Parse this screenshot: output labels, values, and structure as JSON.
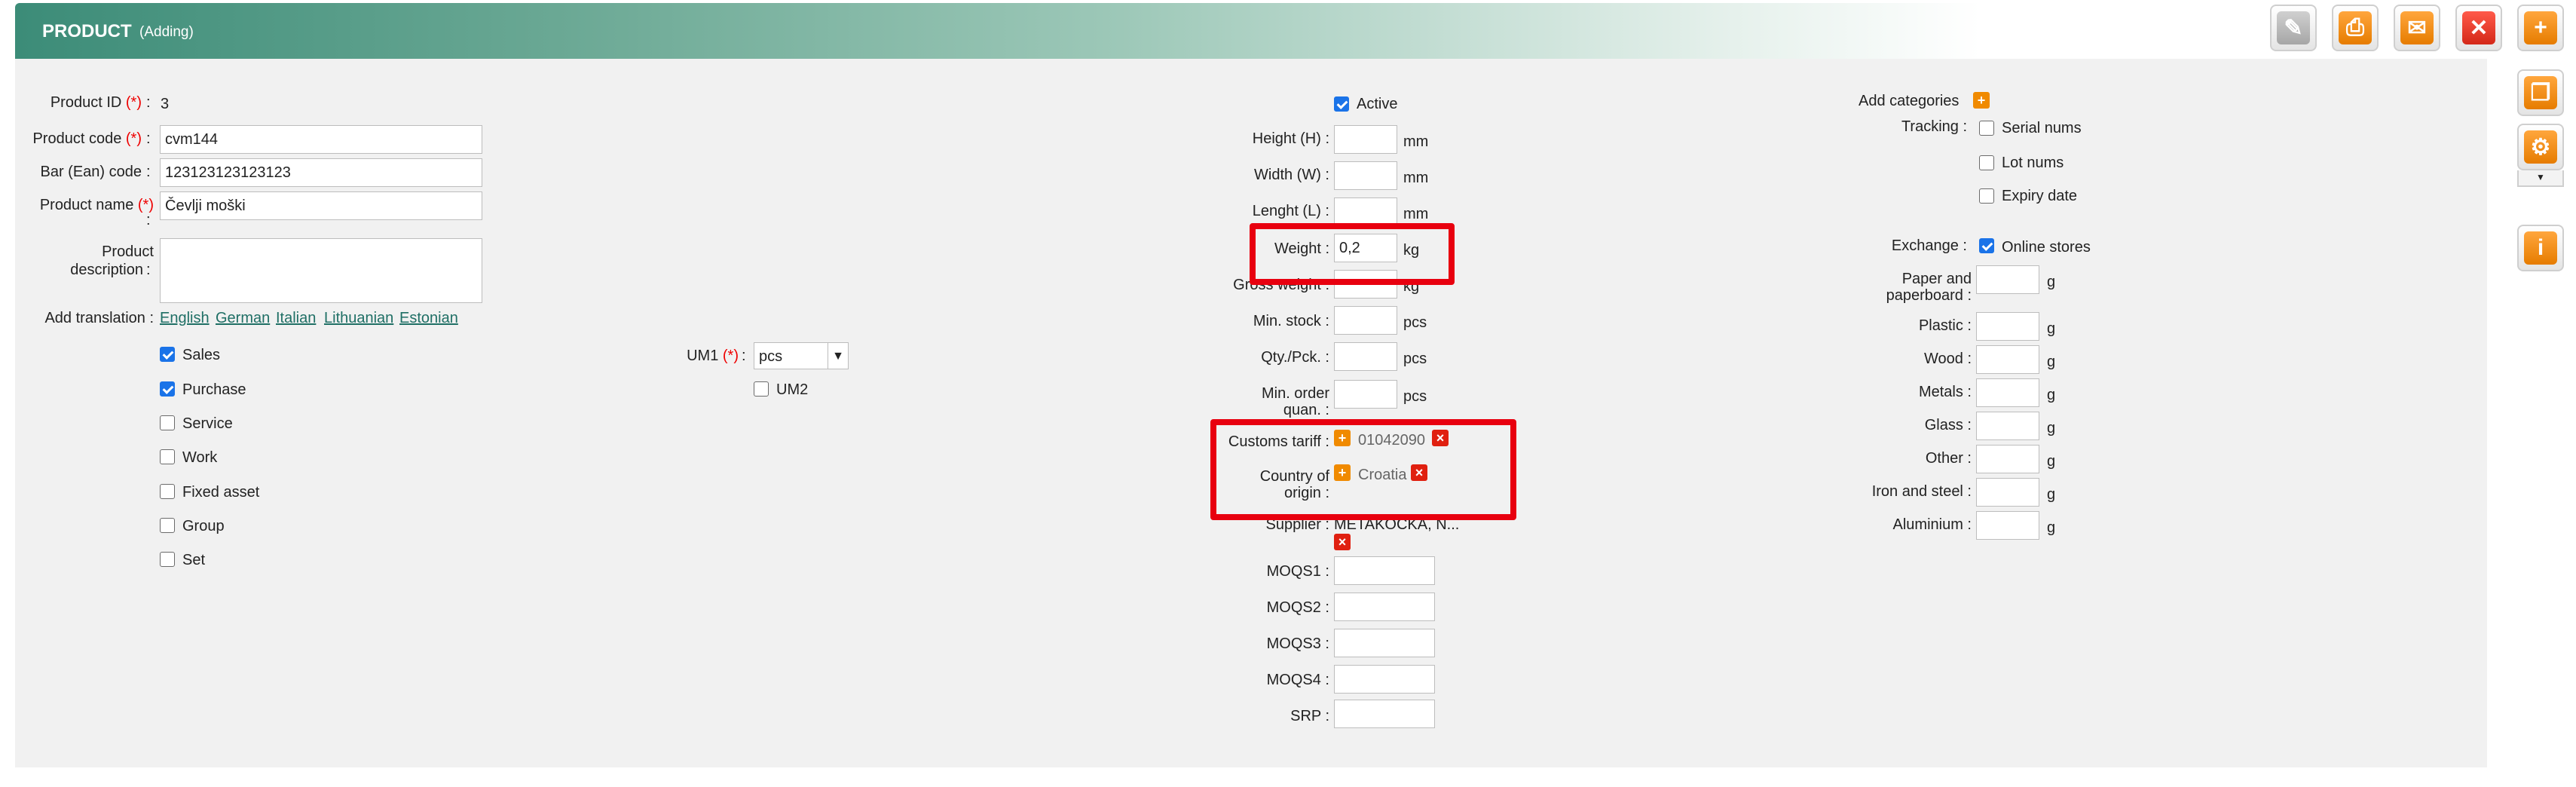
{
  "header": {
    "title": "PRODUCT",
    "subtitle": "(Adding)"
  },
  "toolbar": {
    "edit_icon": "pencil-icon",
    "print_icon": "printer-icon",
    "mail_icon": "envelope-icon",
    "close_icon": "close-icon",
    "add_icon": "plus-icon",
    "copy_icon": "copy-icon",
    "settings_icon": "gear-icon",
    "info_icon": "info-icon"
  },
  "left": {
    "product_id_label": "Product ID",
    "product_id_value": "3",
    "product_code_label": "Product code",
    "product_code_value": "cvm144",
    "barcode_label": "Bar (Ean) code",
    "barcode_value": "123123123123123",
    "product_name_label": "Product name",
    "product_name_value": "Čevlji moški",
    "description_label_1": "Product",
    "description_label_2": "description",
    "description_value": "",
    "required_mark": "(*)",
    "colon": ":",
    "add_translation_label": "Add translation :",
    "translations": [
      "English",
      "German",
      "Italian",
      "Lithuanian",
      "Estonian"
    ],
    "flags": [
      {
        "label": "Sales",
        "checked": true
      },
      {
        "label": "Purchase",
        "checked": true
      },
      {
        "label": "Service",
        "checked": false
      },
      {
        "label": "Work",
        "checked": false
      },
      {
        "label": "Fixed asset",
        "checked": false
      },
      {
        "label": "Group",
        "checked": false
      },
      {
        "label": "Set",
        "checked": false
      }
    ],
    "um1_label": "UM1",
    "um1_value": "pcs",
    "um2_label": "UM2",
    "um2_checked": false
  },
  "middle": {
    "active_label": "Active",
    "active_checked": true,
    "height_label": "Height (H) :",
    "width_label": "Width (W) :",
    "length_label": "Lenght (L) :",
    "weight_label": "Weight :",
    "weight_value": "0,2",
    "gross_weight_label": "Gross weight :",
    "min_stock_label": "Min. stock :",
    "qty_pck_label": "Qty./Pck. :",
    "min_order_label_1": "Min. order",
    "min_order_label_2": "quan. :",
    "unit_mm": "mm",
    "unit_kg": "kg",
    "unit_pcs": "pcs",
    "customs_tariff_label": "Customs tariff :",
    "customs_tariff_value": "01042090",
    "country_label_1": "Country of",
    "country_label_2": "origin :",
    "country_value": "Croatia",
    "supplier_label": "Supplier :",
    "supplier_value": "METAKOCKA, N...",
    "moqs1_label": "MOQS1 :",
    "moqs2_label": "MOQS2 :",
    "moqs3_label": "MOQS3 :",
    "moqs4_label": "MOQS4 :",
    "srp_label": "SRP :"
  },
  "right": {
    "add_categories_label": "Add categories",
    "tracking_label": "Tracking :",
    "serial_label": "Serial nums",
    "lot_label": "Lot nums",
    "expiry_label": "Expiry date",
    "exchange_label": "Exchange :",
    "online_stores_label": "Online stores",
    "online_stores_checked": true,
    "paper_label_1": "Paper and",
    "paper_label_2": "paperboard :",
    "plastic_label": "Plastic :",
    "wood_label": "Wood :",
    "metals_label": "Metals :",
    "glass_label": "Glass :",
    "other_label": "Other :",
    "iron_label": "Iron and steel :",
    "aluminium_label": "Aluminium :",
    "unit_g": "g"
  },
  "colors": {
    "accent": "#3c8c78",
    "highlight": "#e8000f",
    "link": "#1f6f65",
    "orange": "#f08a00"
  }
}
